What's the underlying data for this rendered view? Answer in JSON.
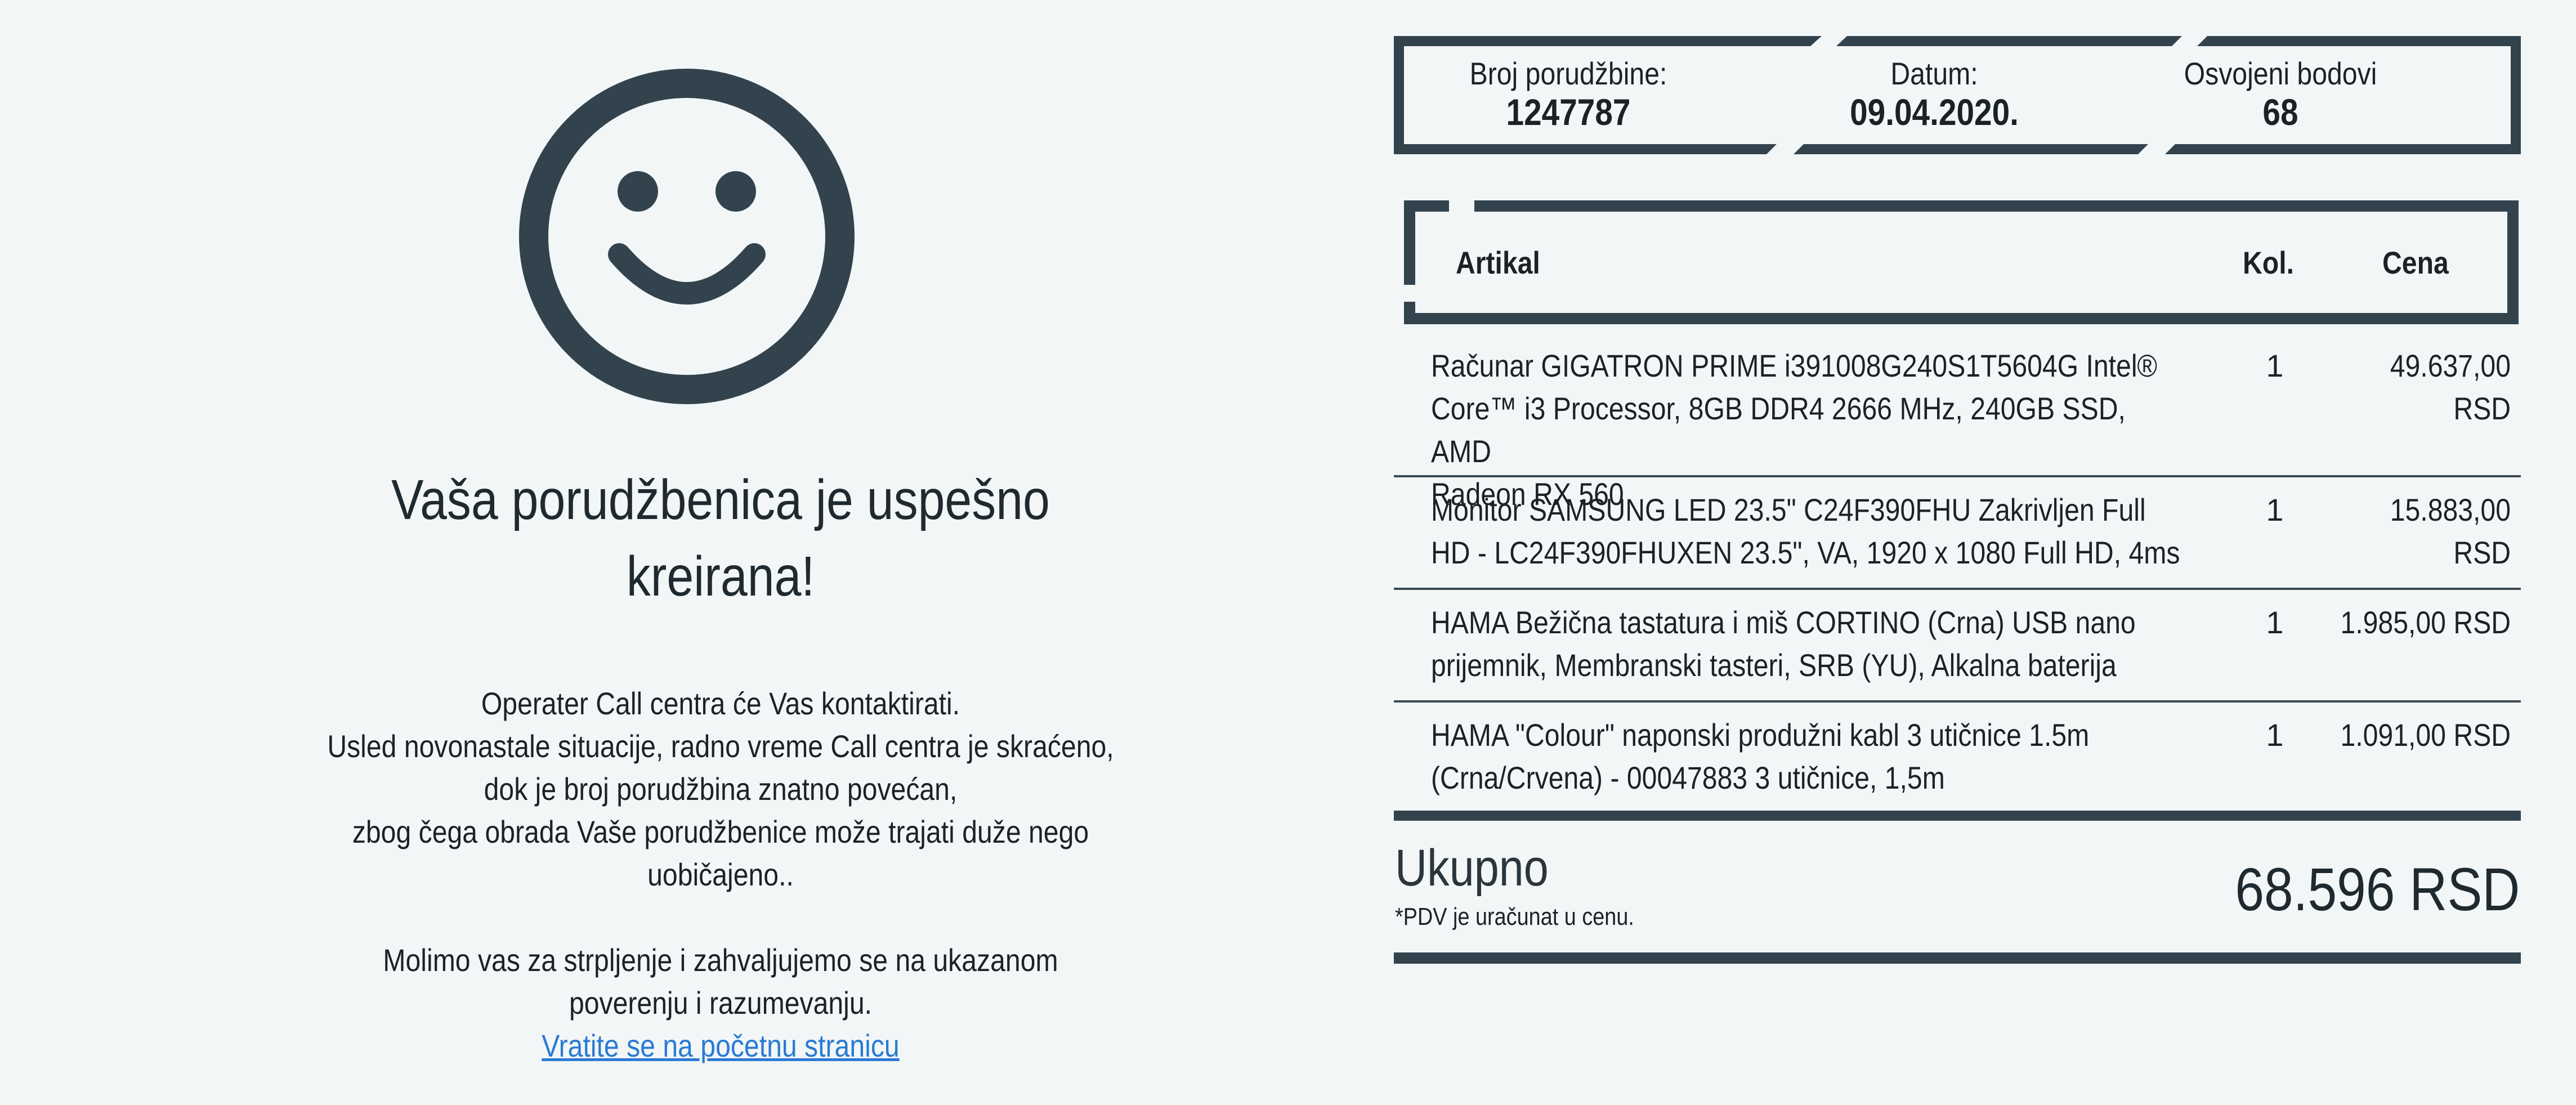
{
  "confirmation": {
    "icon": "smiley-icon",
    "title_line1": "Vaša porudžbenica je uspešno",
    "title_line2": "kreirana!",
    "notice_lines": [
      "Operater Call centra će Vas kontaktirati.",
      "Usled novonastale situacije, radno vreme Call centra je skraćeno,",
      "dok je broj porudžbina znatno povećan,",
      "zbog čega obrada Vaše porudžbenice može trajati duže nego",
      "uobičajeno.."
    ],
    "thanks_lines": [
      "Molimo vas za strpljenje i zahvaljujemo se na ukazanom",
      "poverenju i razumevanju."
    ],
    "home_link": "Vratite se na početnu stranicu"
  },
  "order": {
    "number_label": "Broj porudžbine:",
    "number_value": "1247787",
    "date_label": "Datum:",
    "date_value": "09.04.2020.",
    "points_label": "Osvojeni bodovi",
    "points_value": "68"
  },
  "table": {
    "col_article": "Artikal",
    "col_qty": "Kol.",
    "col_price": "Cena",
    "rows": [
      {
        "name_lines": [
          "Računar GIGATRON PRIME i391008G240S1T5604G Intel®",
          "Core™ i3 Processor, 8GB DDR4 2666 MHz, 240GB SSD, AMD",
          "Radeon RX 560"
        ],
        "qty": "1",
        "price": "49.637,00 RSD"
      },
      {
        "name_lines": [
          "Monitor SAMSUNG LED 23.5\" C24F390FHU Zakrivljen Full",
          "HD - LC24F390FHUXEN 23.5\", VA, 1920 x 1080 Full HD, 4ms"
        ],
        "qty": "1",
        "price": "15.883,00 RSD"
      },
      {
        "name_lines": [
          "HAMA Bežična tastatura i miš CORTINO (Crna) USB nano",
          "prijemnik, Membranski tasteri, SRB (YU), Alkalna baterija"
        ],
        "qty": "1",
        "price": "1.985,00 RSD"
      },
      {
        "name_lines": [
          "HAMA \"Colour\" naponski produžni kabl 3 utičnice 1.5m",
          "(Crna/Crvena) - 00047883 3 utičnice, 1,5m"
        ],
        "qty": "1",
        "price": "1.091,00 RSD"
      }
    ]
  },
  "total": {
    "label": "Ukupno",
    "vat_note": "*PDV je uračunat u cenu.",
    "value": "68.596 RSD"
  },
  "colors": {
    "background": "#f2f6f7",
    "frame": "#33434d",
    "link": "#2a7ad3",
    "text": "#1b2227"
  }
}
